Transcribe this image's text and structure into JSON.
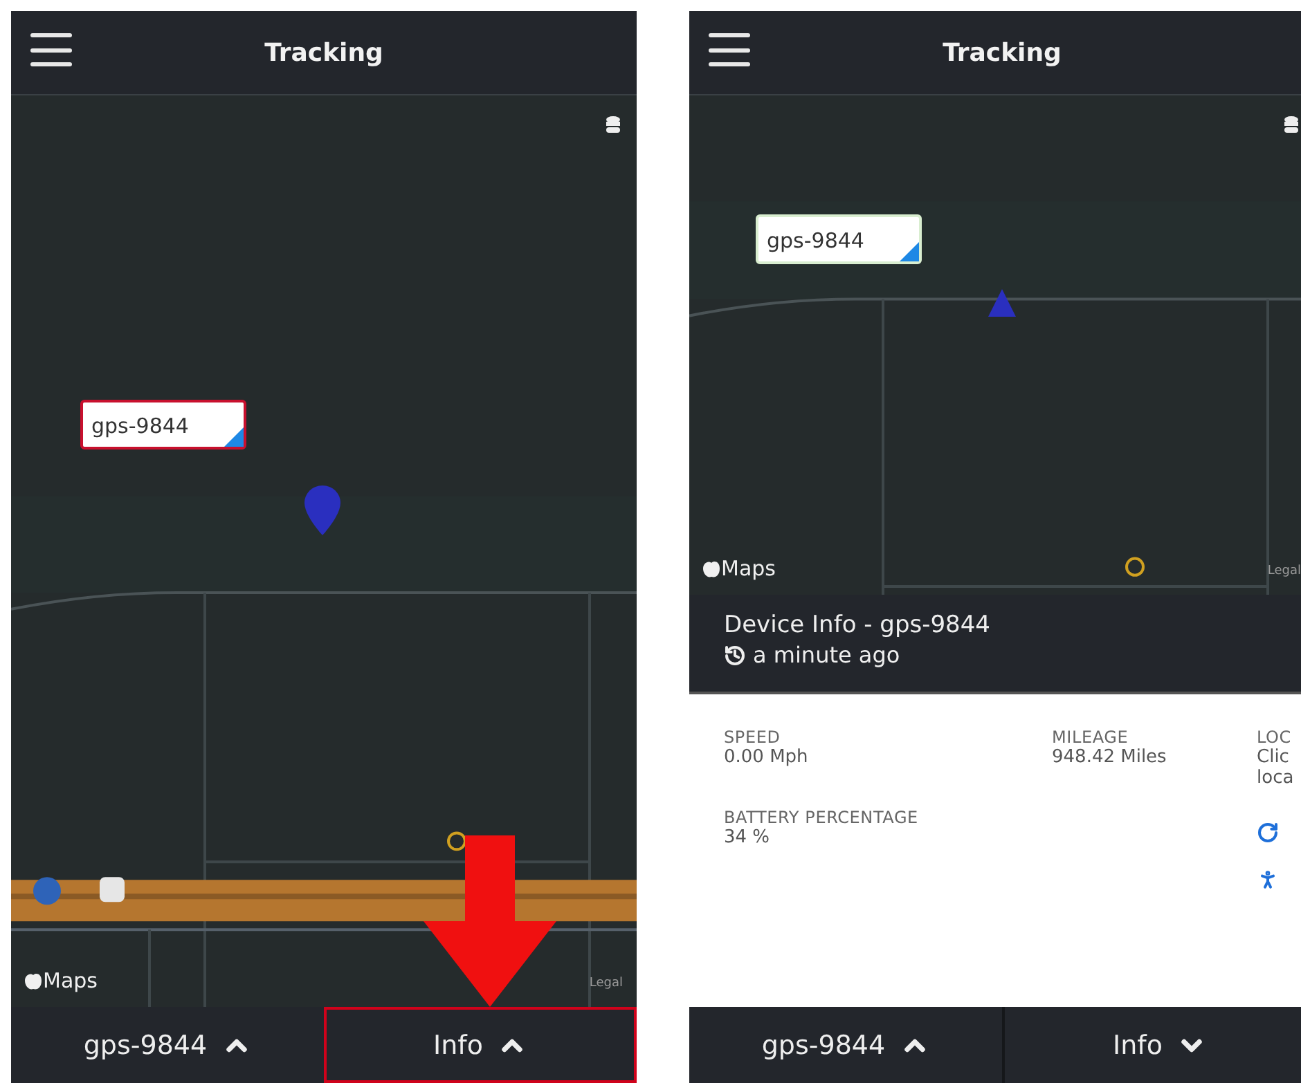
{
  "screens": [
    {
      "header": {
        "title": "Tracking"
      },
      "map": {
        "marker": {
          "label": "gps-9844",
          "selected": true,
          "kind": "pin"
        },
        "attribution": "Maps",
        "legal": "Legal"
      },
      "annotation": {
        "kind": "arrow"
      },
      "bottom_bar": [
        {
          "label": "gps-9844",
          "expanded": false,
          "highlighted": false
        },
        {
          "label": "Info",
          "expanded": false,
          "highlighted": true
        }
      ]
    },
    {
      "header": {
        "title": "Tracking"
      },
      "map": {
        "marker": {
          "label": "gps-9844",
          "selected": false,
          "kind": "triangle"
        },
        "attribution": "Maps",
        "legal": "Legal"
      },
      "device_info": {
        "title": "Device Info - gps-9844",
        "updated": "a minute ago",
        "fields": [
          {
            "label": "SPEED",
            "value": [
              "0.00 Mph"
            ]
          },
          {
            "label": "MILEAGE",
            "value": [
              "948.42 Miles"
            ]
          },
          {
            "label": "LOC",
            "value": [
              "Clic",
              "loca"
            ]
          },
          {
            "label": "BATTERY PERCENTAGE",
            "value": [
              "34 %"
            ]
          }
        ],
        "actions": [
          {
            "kind": "refresh"
          },
          {
            "kind": "person"
          }
        ]
      },
      "bottom_bar": [
        {
          "label": "gps-9844",
          "expanded": false,
          "highlighted": false
        },
        {
          "label": "Info",
          "expanded": true,
          "highlighted": false
        }
      ]
    }
  ]
}
